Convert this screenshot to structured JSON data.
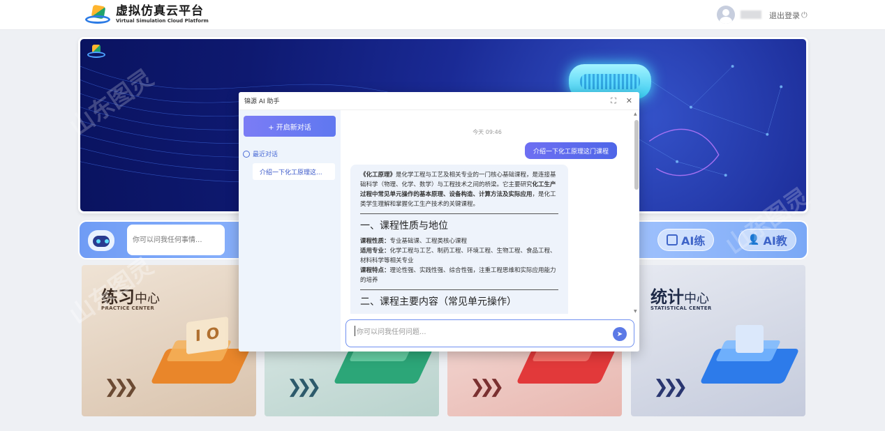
{
  "header": {
    "title_cn": "虚拟仿真云平台",
    "title_en": "Virtual Simulation Cloud Platform",
    "logout_label": "退出登录",
    "logout_icon": "power-icon"
  },
  "search": {
    "placeholder": "你可以问我任何事情..."
  },
  "pills": [
    {
      "label": "AI练",
      "icon": "book-icon"
    },
    {
      "label": "AI教",
      "icon": "teacher-icon"
    }
  ],
  "cards": [
    {
      "title_main": "练习",
      "title_sub": "中心",
      "en": "PRACTICE CENTER",
      "color": "#e6d4c0"
    },
    {
      "title_main": "",
      "title_sub": "",
      "en": "",
      "color": "#cfe0dc"
    },
    {
      "title_main": "",
      "title_sub": "",
      "en": "",
      "color": "#f1d3cf"
    },
    {
      "title_main": "统计",
      "title_sub": "中心",
      "en": "STATISTICAL CENTER",
      "color": "#d6dbe8"
    }
  ],
  "dialog": {
    "title": "锦源 AI 助手",
    "new_chat": "+ 开启新对话",
    "recent_label": "最近对话",
    "history_item": "介绍一下化工原理这...",
    "timestamp": "今天 09:46",
    "user_message": "介绍一下化工原理这门课程",
    "ai": {
      "intro_bold": "《化工原理》",
      "intro_1": "是化学工程与工艺及相关专业的一门核心基础课程，是连接基础科学（物理、化学、数学）与工程技术之间的桥梁。它主要研究",
      "intro_bold2": "化工生产过程中常见单元操作的基本原理、设备构造、计算方法及实际应用",
      "intro_2": "，是化工类学生理解和掌握化工生产技术的关键课程。",
      "h1": "一、课程性质与地位",
      "nature_label": "课程性质：",
      "nature": "专业基础课、工程类核心课程",
      "major_label": "适用专业：",
      "major": "化学工程与工艺、制药工程、环境工程、生物工程、食品工程、材料科学等相关专业",
      "feature_label": "课程特点：",
      "feature": "理论性强、实践性强、综合性强，注重工程思维和实际应用能力的培养",
      "h2": "二、课程主要内容（常见单元操作）"
    },
    "input_placeholder": "你可以问我任何问题..."
  }
}
